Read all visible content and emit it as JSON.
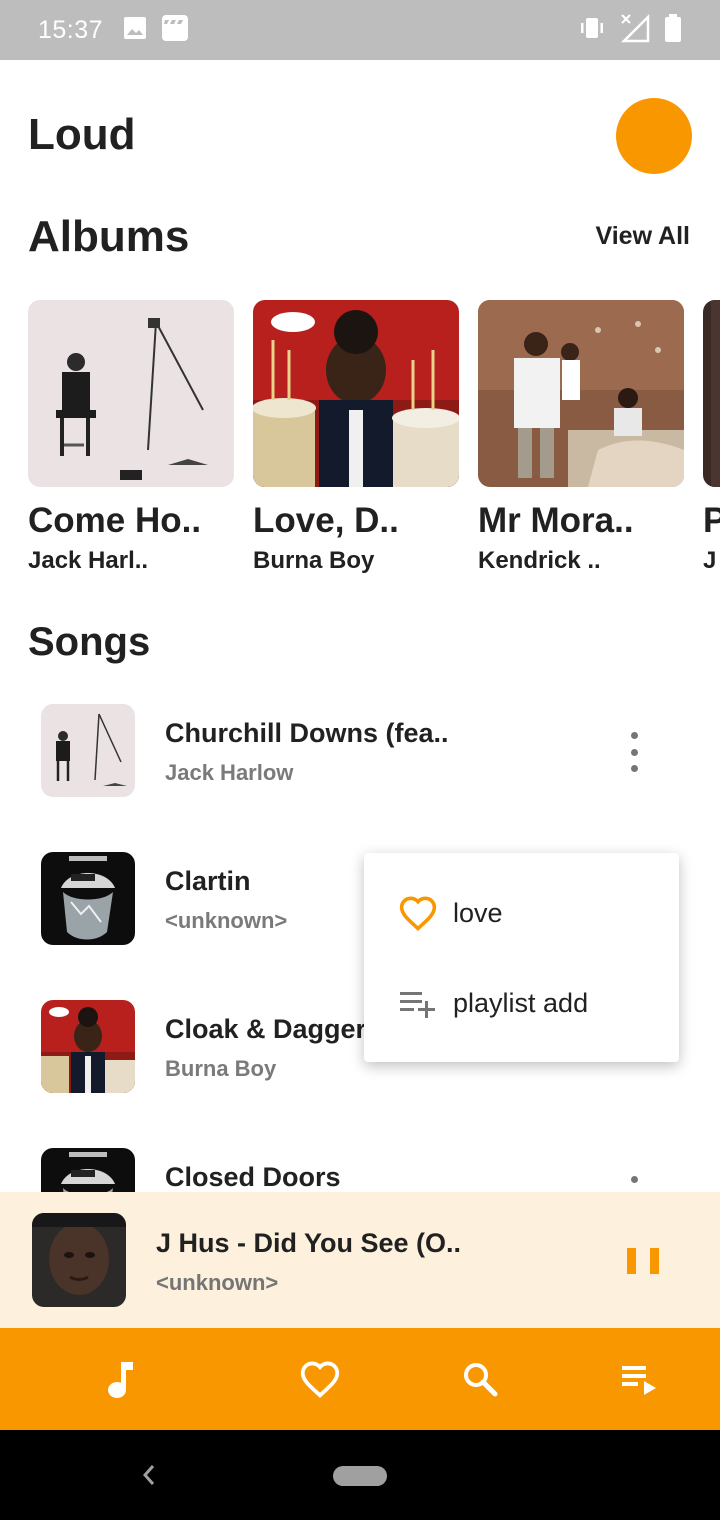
{
  "status_bar": {
    "time": "15:37",
    "icons": [
      "image-icon",
      "clapperboard-icon",
      "vibrate-icon",
      "no-signal-icon",
      "battery-icon"
    ]
  },
  "header": {
    "title": "Loud",
    "theme_button_icon": "moon-icon"
  },
  "albums": {
    "title": "Albums",
    "view_all": "View All",
    "items": [
      {
        "title": "Come Ho..",
        "artist": "Jack Harl.."
      },
      {
        "title": "Love, D..",
        "artist": "Burna Boy"
      },
      {
        "title": "Mr Mora..",
        "artist": "Kendrick .."
      },
      {
        "title": "P",
        "artist": "J"
      }
    ]
  },
  "songs": {
    "title": "Songs",
    "items": [
      {
        "title": "Churchill Downs (fea..",
        "artist": "Jack Harlow"
      },
      {
        "title": "Clartin",
        "artist": "<unknown>"
      },
      {
        "title": "Cloak & Dagger",
        "artist": "Burna Boy"
      },
      {
        "title": "Closed Doors",
        "artist": ""
      }
    ]
  },
  "popup_menu": {
    "items": [
      {
        "label": "love",
        "icon": "heart-outline-icon"
      },
      {
        "label": "playlist add",
        "icon": "playlist-add-icon"
      }
    ]
  },
  "now_playing": {
    "title": "J Hus - Did You See (O..",
    "artist": "<unknown>",
    "state_icon": "pause-icon"
  },
  "bottom_nav": {
    "items": [
      "music-note-icon",
      "heart-outline-icon",
      "search-icon",
      "queue-icon"
    ]
  },
  "colors": {
    "accent": "#f99700",
    "mini_player_bg": "#fdf1de",
    "status_bar": "#bdbdbd",
    "secondary_text": "#7a7a7a"
  }
}
